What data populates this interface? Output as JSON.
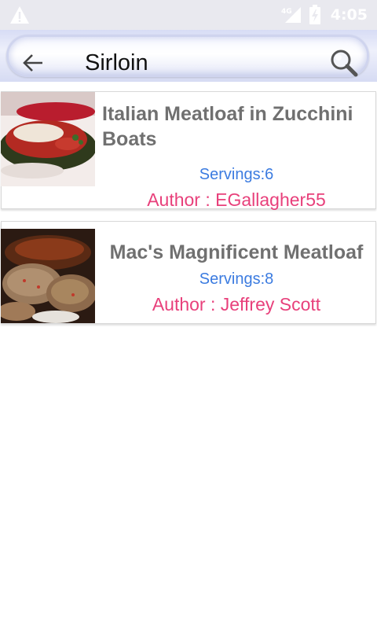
{
  "status_bar": {
    "time": "4:05",
    "network_label": "4G",
    "icons": [
      "warning-icon",
      "signal-icon",
      "battery-charging-icon"
    ]
  },
  "search": {
    "query": "Sirloin",
    "back_icon": "back-arrow-icon",
    "search_icon": "search-icon"
  },
  "results": [
    {
      "title": "Italian Meatloaf in Zucchini Boats",
      "servings": "Servings:6",
      "author": "Author : EGallagher55",
      "image": "zucchini-meatloaf-photo"
    },
    {
      "title": "Mac's Magnificent Meatloaf",
      "servings": "Servings:8",
      "author": "Author : Jeffrey Scott",
      "image": "meatloaf-slices-photo"
    }
  ],
  "colors": {
    "title": "#707070",
    "servings": "#3b7be0",
    "author": "#e8407b",
    "status_bar": "#e9e9ef"
  }
}
